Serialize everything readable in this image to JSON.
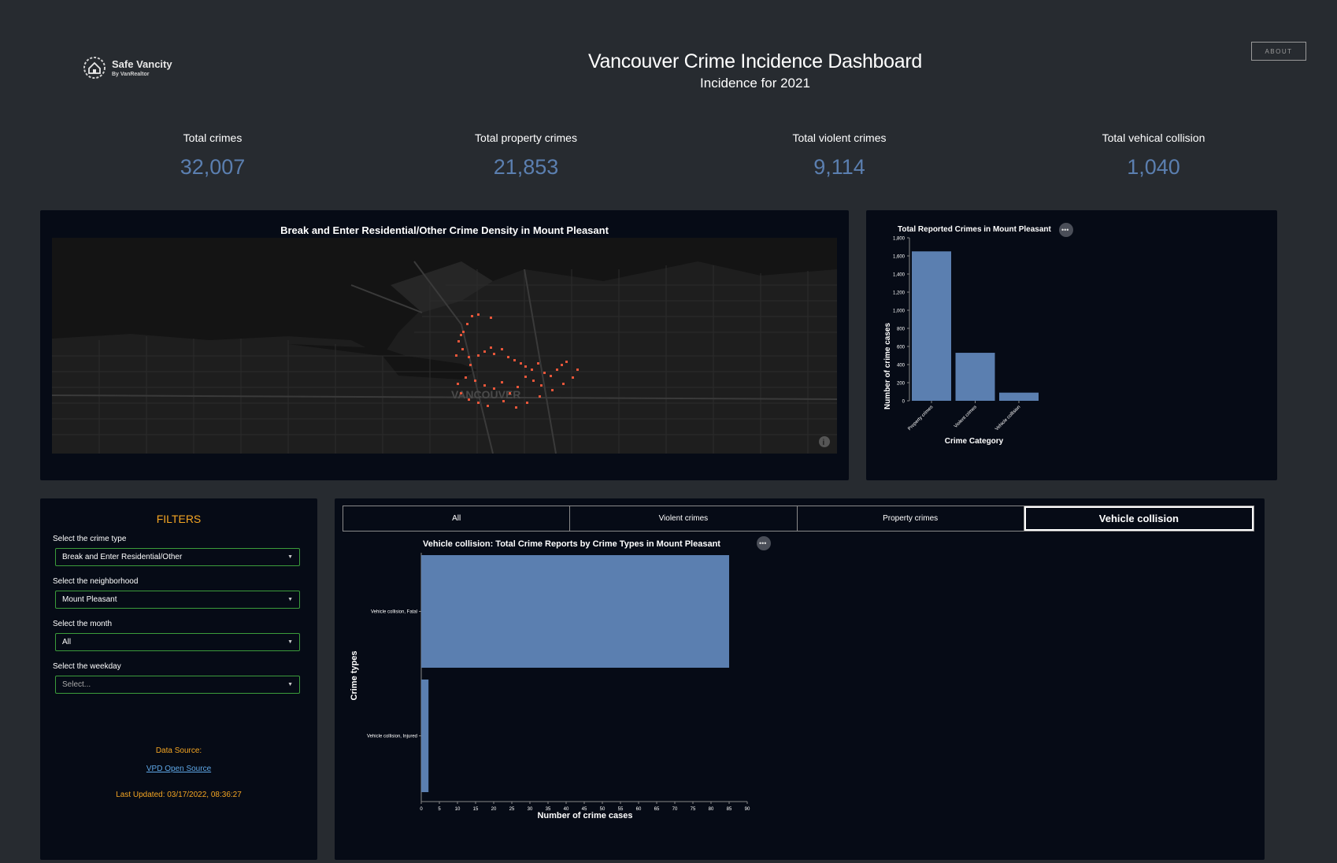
{
  "header": {
    "logo_name": "Safe Vancity",
    "logo_sub": "By VanRealtor",
    "title": "Vancouver Crime Incidence Dashboard",
    "subtitle": "Incidence for 2021",
    "about_label": "ABOUT"
  },
  "stats": [
    {
      "label": "Total crimes",
      "value": "32,007"
    },
    {
      "label": "Total property crimes",
      "value": "21,853"
    },
    {
      "label": "Total violent crimes",
      "value": "9,114"
    },
    {
      "label": "Total vehical collision",
      "value": "1,040"
    }
  ],
  "map": {
    "title": "Break and Enter Residential/Other Crime Density in Mount Pleasant",
    "city_label": "VANCOUVER",
    "info_icon": "info-icon",
    "point_color": "#e8563a"
  },
  "filters": {
    "title": "FILTERS",
    "crime_type_label": "Select the crime type",
    "crime_type_value": "Break and Enter Residential/Other",
    "neighborhood_label": "Select the neighborhood",
    "neighborhood_value": "Mount Pleasant",
    "month_label": "Select the month",
    "month_value": "All",
    "weekday_label": "Select the weekday",
    "weekday_placeholder": "Select...",
    "data_source_label": "Data Source:",
    "data_source_link": "VPD Open Source",
    "last_updated": "Last Updated: 03/17/2022, 08:36:27"
  },
  "tabs": [
    {
      "label": "All",
      "active": false
    },
    {
      "label": "Violent crimes",
      "active": false
    },
    {
      "label": "Property crimes",
      "active": false
    },
    {
      "label": "Vehicle collision",
      "active": true
    }
  ],
  "chart_data": [
    {
      "type": "bar",
      "title": "Total Reported Crimes in Mount Pleasant",
      "xlabel": "Crime Category",
      "ylabel": "Number of crime cases",
      "categories": [
        "Property crimes",
        "Violent crimes",
        "Vehicle collision"
      ],
      "values": [
        1650,
        530,
        90
      ],
      "ylim": [
        0,
        1800
      ],
      "yticks": [
        "0",
        "200",
        "400",
        "600",
        "800",
        "1,000",
        "1,200",
        "1,400",
        "1,600",
        "1,800"
      ],
      "color": "#5b7fb0"
    },
    {
      "type": "bar",
      "orientation": "horizontal",
      "title": "Vehicle collision: Total Crime Reports by Crime Types in Mount Pleasant",
      "xlabel": "Number of crime cases",
      "ylabel": "Crime types",
      "categories": [
        "Vehicle collision, Fatal",
        "Vehicle collision, Injured"
      ],
      "values": [
        85,
        2
      ],
      "xlim": [
        0,
        90
      ],
      "xticks": [
        "0",
        "5",
        "10",
        "15",
        "20",
        "25",
        "30",
        "35",
        "40",
        "45",
        "50",
        "55",
        "60",
        "65",
        "70",
        "75",
        "80",
        "85",
        "90"
      ],
      "color": "#5b7fb0"
    }
  ]
}
